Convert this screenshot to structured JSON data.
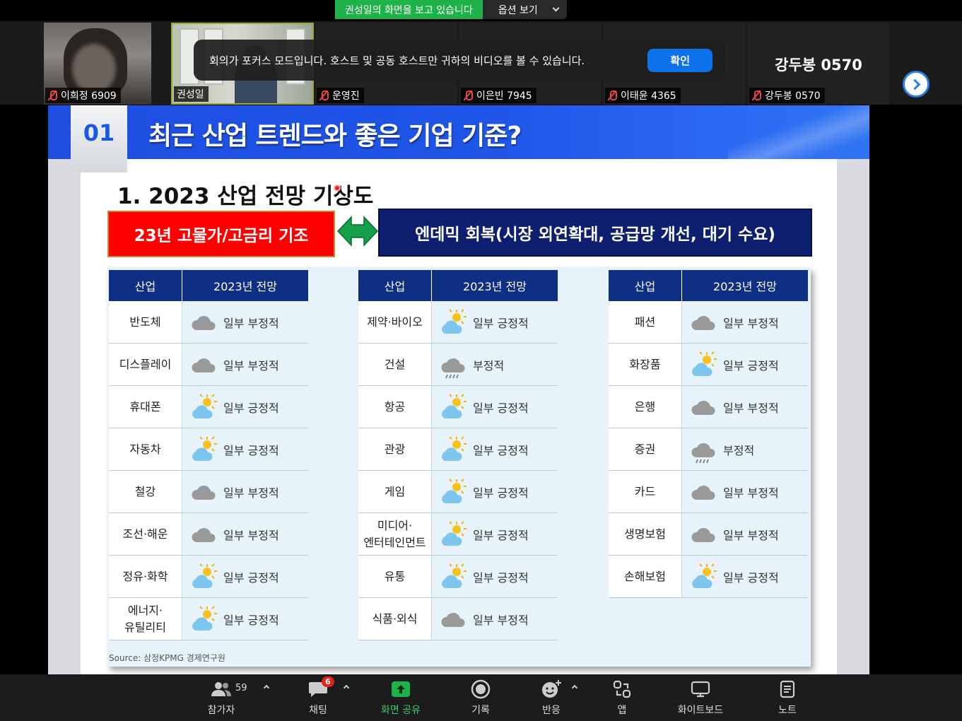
{
  "share_banner": {
    "status": "권성일의 화면을 보고 있습니다",
    "view_options": "옵션 보기"
  },
  "participants": [
    {
      "name": "이희정 6909",
      "muted": true
    },
    {
      "name": "권성일",
      "muted": false
    },
    {
      "name": "운영진",
      "muted": true
    },
    {
      "name": "이은빈 7945",
      "muted": true
    },
    {
      "name": "이태윤 4365",
      "muted": true
    },
    {
      "name": "강두봉 0570",
      "muted": true,
      "center_name": "강두봉 0570"
    }
  ],
  "focus_toast": {
    "message": "회의가 포커스 모드입니다. 호스트 및 공동 호스트만 귀하의 비디오를 볼 수 있습니다.",
    "button": "확인"
  },
  "slide": {
    "number": "01",
    "title": "최근 산업 트렌드와 좋은 기업 기준?",
    "section_title": "1. 2023 산업 전망 기상도",
    "red_box": "23년 고물가/고금리 기조",
    "navy_box": "엔데믹 회복(시장 외연확대, 공급망 개선, 대기 수요)",
    "table_headers": {
      "industry": "산업",
      "outlook": "2023년 전망"
    },
    "tables": [
      [
        {
          "industry": "반도체",
          "outlook": "일부 부정적",
          "icon": "cloud-icon"
        },
        {
          "industry": "디스플레이",
          "outlook": "일부 부정적",
          "icon": "cloud-icon"
        },
        {
          "industry": "휴대폰",
          "outlook": "일부 긍정적",
          "icon": "sun-cloud-icon"
        },
        {
          "industry": "자동차",
          "outlook": "일부 긍정적",
          "icon": "sun-cloud-icon"
        },
        {
          "industry": "철강",
          "outlook": "일부 부정적",
          "icon": "cloud-icon"
        },
        {
          "industry": "조선·해운",
          "outlook": "일부 부정적",
          "icon": "cloud-icon"
        },
        {
          "industry": "정유·화학",
          "outlook": "일부 긍정적",
          "icon": "sun-cloud-icon"
        },
        {
          "industry": "에너지·\n유틸리티",
          "outlook": "일부 긍정적",
          "icon": "sun-cloud-icon"
        }
      ],
      [
        {
          "industry": "제약·바이오",
          "outlook": "일부 긍정적",
          "icon": "sun-cloud-icon"
        },
        {
          "industry": "건설",
          "outlook": "부정적",
          "icon": "rain-cloud-icon"
        },
        {
          "industry": "항공",
          "outlook": "일부 긍정적",
          "icon": "sun-cloud-icon"
        },
        {
          "industry": "관광",
          "outlook": "일부 긍정적",
          "icon": "sun-cloud-icon"
        },
        {
          "industry": "게임",
          "outlook": "일부 긍정적",
          "icon": "sun-cloud-icon"
        },
        {
          "industry": "미디어·\n엔터테인먼트",
          "outlook": "일부 긍정적",
          "icon": "sun-cloud-icon"
        },
        {
          "industry": "유통",
          "outlook": "일부 긍정적",
          "icon": "sun-cloud-icon"
        },
        {
          "industry": "식품·외식",
          "outlook": "일부 부정적",
          "icon": "cloud-icon"
        }
      ],
      [
        {
          "industry": "패션",
          "outlook": "일부 부정적",
          "icon": "cloud-icon"
        },
        {
          "industry": "화장품",
          "outlook": "일부 긍정적",
          "icon": "sun-cloud-icon"
        },
        {
          "industry": "은행",
          "outlook": "일부 부정적",
          "icon": "cloud-icon"
        },
        {
          "industry": "증권",
          "outlook": "부정적",
          "icon": "rain-cloud-icon"
        },
        {
          "industry": "카드",
          "outlook": "일부 부정적",
          "icon": "cloud-icon"
        },
        {
          "industry": "생명보험",
          "outlook": "일부 부정적",
          "icon": "cloud-icon"
        },
        {
          "industry": "손해보험",
          "outlook": "일부 긍정적",
          "icon": "sun-cloud-icon"
        }
      ]
    ],
    "source": "Source: 삼정KPMG 경제연구원"
  },
  "toolbar": {
    "participants": {
      "label": "참가자",
      "count": "59"
    },
    "chat": {
      "label": "채팅",
      "badge": "6"
    },
    "share": {
      "label": "화면 공유"
    },
    "record": {
      "label": "기록"
    },
    "reactions": {
      "label": "반응"
    },
    "apps": {
      "label": "앱"
    },
    "whiteboard": {
      "label": "화이트보드"
    },
    "notes": {
      "label": "노트"
    }
  },
  "colors": {
    "share_green": "#1fb24a",
    "zoom_blue": "#0e72ed",
    "slide_blue": "#1d4ee0",
    "table_header_navy": "#0f2f84",
    "red_box": "#ff0000",
    "navy_box": "#0d1f6e",
    "mute_red": "#e84848"
  }
}
